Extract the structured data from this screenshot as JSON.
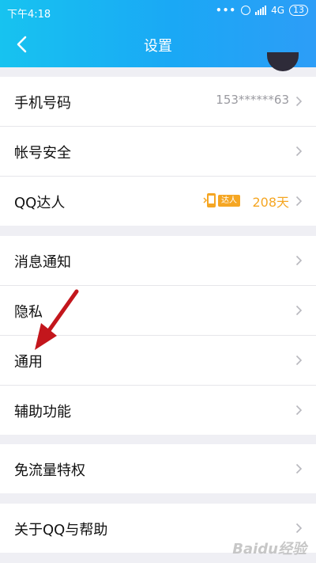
{
  "status": {
    "time": "下午4:18",
    "dots": "•••",
    "network": "4G",
    "battery": "13"
  },
  "nav": {
    "title": "设置"
  },
  "sections": [
    {
      "rows": [
        {
          "label": "手机号码",
          "value": "153******63"
        },
        {
          "label": "帐号安全"
        },
        {
          "label": "QQ达人",
          "badge": "达人",
          "days": "208天"
        }
      ]
    },
    {
      "rows": [
        {
          "label": "消息通知"
        },
        {
          "label": "隐私"
        },
        {
          "label": "通用"
        },
        {
          "label": "辅助功能"
        }
      ]
    },
    {
      "rows": [
        {
          "label": "免流量特权"
        }
      ]
    },
    {
      "rows": [
        {
          "label": "关于QQ与帮助"
        }
      ]
    }
  ],
  "watermark": "Baidu经验",
  "colors": {
    "header_start": "#17c3f0",
    "header_end": "#2d9df7",
    "badge": "#f5a623",
    "annotation_arrow": "#c3161c"
  }
}
